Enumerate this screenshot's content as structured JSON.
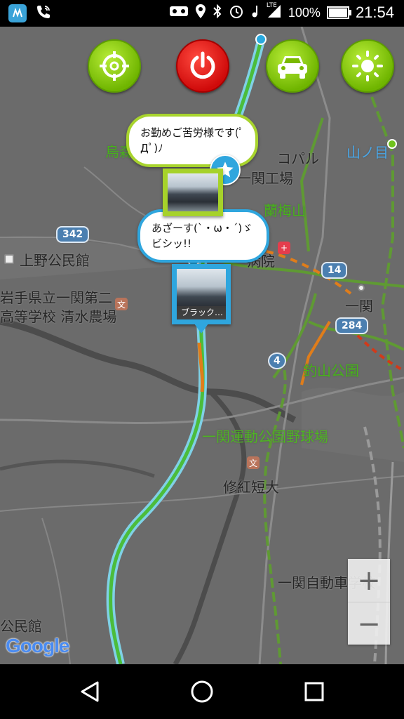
{
  "status_bar": {
    "time": "21:54",
    "battery": "100%",
    "battery_fraction": 1.0,
    "network": "LTE"
  },
  "map": {
    "labels": {
      "karasu": "烏森",
      "factory": "一関工場",
      "kopal": "コパル",
      "yamanome": "山ノ目",
      "rambaisan": "蘭梅山",
      "ueno": "上野公民館",
      "hospital": "病院",
      "school1": "岩手県立一関第二",
      "school2": "高等学校 清水農場",
      "ichinoseki": "一関",
      "tsuriyama": "釣山公園",
      "baseball": "一関運動公園野球場",
      "shukoku": "修紅短大",
      "highway": "一関自動車学校",
      "komin": "公民館"
    },
    "routes": {
      "r342": "342",
      "r14": "14",
      "r284": "284",
      "r4": "4"
    },
    "attribution": "Google"
  },
  "toolbar": {
    "target_icon": "crosshair-icon",
    "power_icon": "power-icon",
    "car_icon": "car-icon",
    "brightness_icon": "sun-icon"
  },
  "bubbles": {
    "top": "お勤めご苦労様です(ﾟДﾟ)ﾉ",
    "bottom_line1": "あざーす(`・ω・´)ゞ",
    "bottom_line2": "ビシッ!!"
  },
  "photo_marker": {
    "caption": "ブラック…"
  },
  "zoom": {
    "in": "+",
    "out": "−"
  },
  "colors": {
    "accent_green": "#8ccc14",
    "accent_red": "#e01515",
    "accent_blue": "#2fa6de"
  }
}
